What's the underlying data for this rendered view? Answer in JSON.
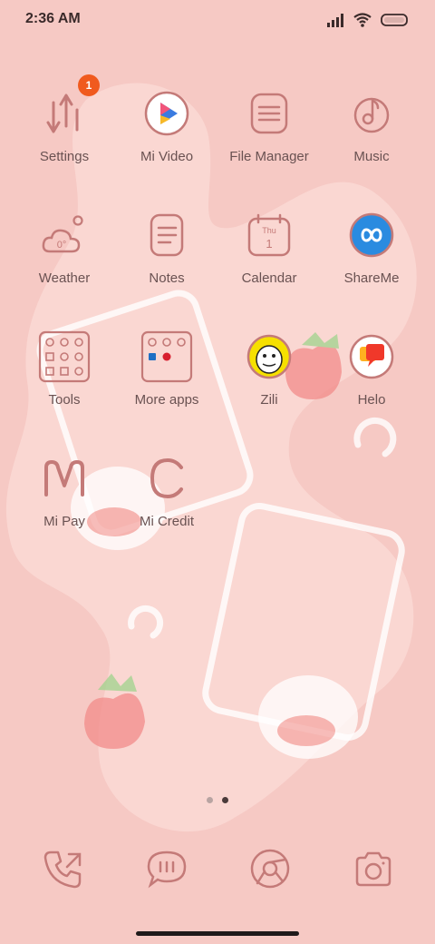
{
  "status_bar": {
    "time": "2:36 AM",
    "icons": [
      "signal-icon",
      "wifi-icon",
      "battery-icon"
    ]
  },
  "apps": [
    {
      "label": "Settings",
      "icon": "settings-icon",
      "badge": "1"
    },
    {
      "label": "Mi Video",
      "icon": "mi-video-icon"
    },
    {
      "label": "File Manager",
      "icon": "file-manager-icon"
    },
    {
      "label": "Music",
      "icon": "music-icon"
    },
    {
      "label": "Weather",
      "icon": "weather-icon",
      "icon_text": "0°"
    },
    {
      "label": "Notes",
      "icon": "notes-icon"
    },
    {
      "label": "Calendar",
      "icon": "calendar-icon",
      "icon_text_day": "Thu",
      "icon_text_date": "1"
    },
    {
      "label": "ShareMe",
      "icon": "shareme-icon"
    },
    {
      "label": "Tools",
      "icon": "tools-folder-icon"
    },
    {
      "label": "More apps",
      "icon": "more-apps-folder-icon"
    },
    {
      "label": "Zili",
      "icon": "zili-icon"
    },
    {
      "label": "Helo",
      "icon": "helo-icon"
    },
    {
      "label": "Mi Pay",
      "icon": "mi-pay-icon"
    },
    {
      "label": "Mi Credit",
      "icon": "mi-credit-icon"
    }
  ],
  "page_indicator": {
    "pages": 2,
    "active": 2
  },
  "dock": [
    {
      "icon": "phone-icon"
    },
    {
      "icon": "messages-icon"
    },
    {
      "icon": "browser-icon"
    },
    {
      "icon": "camera-icon"
    }
  ],
  "colors": {
    "background": "#f6c9c4",
    "icon_stroke": "#c47a78",
    "label": "#6a5252",
    "badge": "#f05a1e"
  }
}
